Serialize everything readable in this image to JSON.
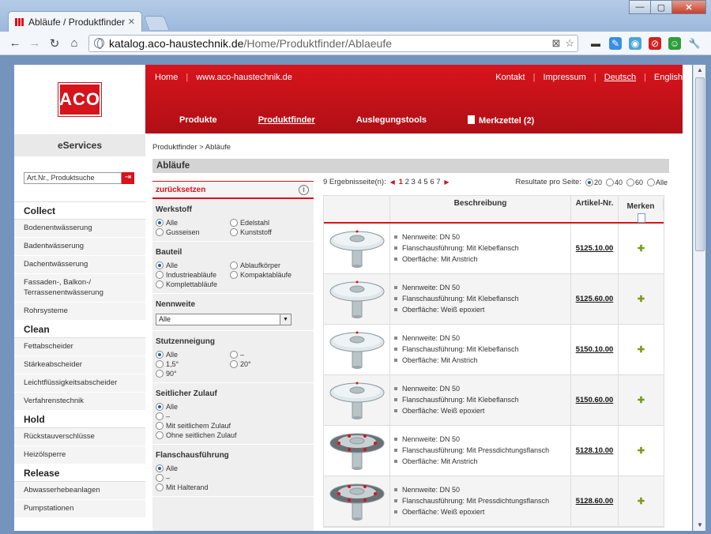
{
  "browser": {
    "tab_title": "Abläufe / Produktfinder",
    "url_host": "katalog.aco-haustechnik.de",
    "url_path": "/Home/Produktfinder/Ablaeufe"
  },
  "site": {
    "logo_text": "ACO",
    "eservices": "eServices",
    "search_placeholder": "Art.Nr., Produktsuche",
    "topnav": {
      "home": "Home",
      "website": "www.aco-haustechnik.de",
      "kontakt": "Kontakt",
      "impressum": "Impressum",
      "deutsch": "Deutsch",
      "english": "English"
    },
    "mainnav": {
      "produkte": "Produkte",
      "produktfinder": "Produktfinder",
      "auslegungstools": "Auslegungstools",
      "merkzettel": "Merkzettel (2)"
    },
    "categories": [
      {
        "head": "Collect",
        "items": [
          "Bodenentwässerung",
          "Badentwässerung",
          "Dachentwässerung",
          "Fassaden-, Balkon-/ Terrassenentwässerung",
          "Rohrsysteme"
        ]
      },
      {
        "head": "Clean",
        "items": [
          "Fettabscheider",
          "Stärkeabscheider",
          "Leichtflüssigkeitsabscheider",
          "Verfahrenstechnik"
        ]
      },
      {
        "head": "Hold",
        "items": [
          "Rückstauverschlüsse",
          "Heizölsperre"
        ]
      },
      {
        "head": "Release",
        "items": [
          "Abwasserhebeanlagen",
          "Pumpstationen"
        ]
      }
    ]
  },
  "content": {
    "breadcrumb": "Produktfinder  >  Abläufe",
    "page_title": "Abläufe",
    "back_label": "zurücksetzen",
    "filters": {
      "werkstoff": {
        "title": "Werkstoff",
        "options": [
          "Alle",
          "Edelstahl",
          "Gusseisen",
          "Kunststoff"
        ]
      },
      "bauteil": {
        "title": "Bauteil",
        "options": [
          "Alle",
          "Ablaufkörper",
          "Industrieabläufe",
          "Kompaktabläufe",
          "Komplettabläufe"
        ]
      },
      "nennweite": {
        "title": "Nennweite",
        "selected": "Alle"
      },
      "stutzen": {
        "title": "Stutzenneigung",
        "options": [
          "Alle",
          "–",
          "1,5°",
          "20°",
          "90°"
        ]
      },
      "zulauf": {
        "title": "Seitlicher Zulauf",
        "options": [
          "Alle",
          "–",
          "Mit seitlichem Zulauf",
          "Ohne seitlichen Zulauf"
        ]
      },
      "flansch": {
        "title": "Flanschausführung",
        "options": [
          "Alle",
          "–",
          "Mit Halterand"
        ]
      }
    },
    "results": {
      "count_label": "9 Ergebnisseite(n):",
      "pages": [
        "1",
        "2",
        "3",
        "4",
        "5",
        "6",
        "7"
      ],
      "per_page_label": "Resultate pro Seite:",
      "per_page_options": [
        "20",
        "40",
        "60",
        "Alle"
      ],
      "columns": {
        "beschreibung": "Beschreibung",
        "artikel": "Artikel-Nr.",
        "merken": "Merken"
      },
      "rows": [
        {
          "type": "klebe",
          "desc": [
            "Nennweite: DN 50",
            "Flanschausführung: Mit Klebeflansch",
            "Oberfläche: Mit Anstrich"
          ],
          "art": "5125.10.00"
        },
        {
          "type": "klebe",
          "desc": [
            "Nennweite: DN 50",
            "Flanschausführung: Mit Klebeflansch",
            "Oberfläche: Weiß epoxiert"
          ],
          "art": "5125.60.00"
        },
        {
          "type": "klebe",
          "desc": [
            "Nennweite: DN 50",
            "Flanschausführung: Mit Klebeflansch",
            "Oberfläche: Mit Anstrich"
          ],
          "art": "5150.10.00"
        },
        {
          "type": "klebe",
          "desc": [
            "Nennweite: DN 50",
            "Flanschausführung: Mit Klebeflansch",
            "Oberfläche: Weiß epoxiert"
          ],
          "art": "5150.60.00"
        },
        {
          "type": "press",
          "desc": [
            "Nennweite: DN 50",
            "Flanschausführung: Mit Pressdichtungsflansch",
            "Oberfläche: Mit Anstrich"
          ],
          "art": "5128.10.00"
        },
        {
          "type": "press",
          "desc": [
            "Nennweite: DN 50",
            "Flanschausführung: Mit Pressdichtungsflansch",
            "Oberfläche: Weiß epoxiert"
          ],
          "art": "5128.60.00"
        }
      ]
    }
  }
}
